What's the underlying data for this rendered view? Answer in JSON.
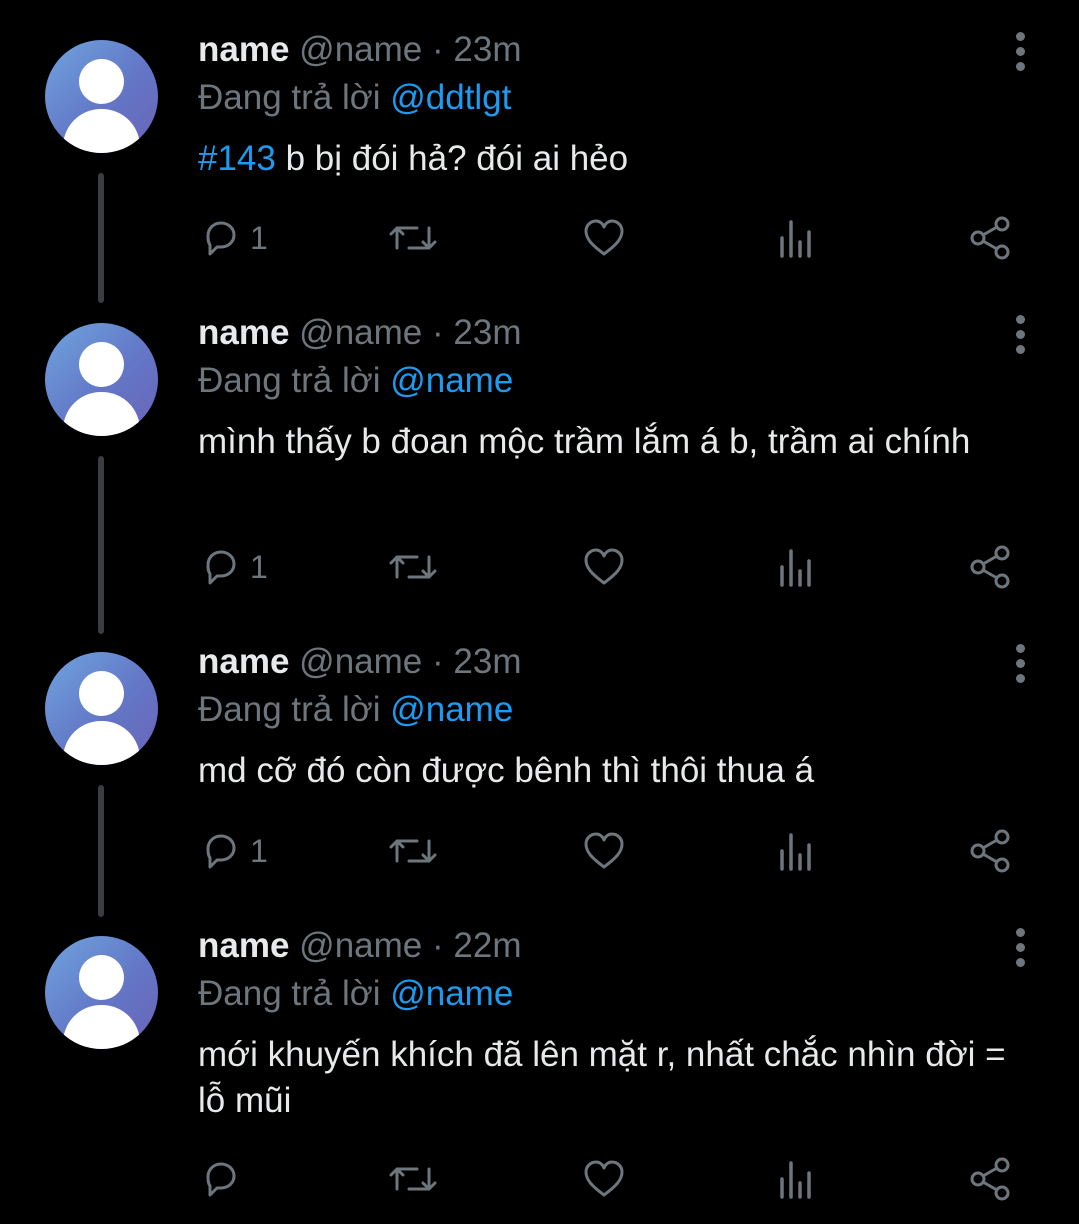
{
  "tweets": [
    {
      "name": "name",
      "handle": "@name",
      "time": "23m",
      "replying_label": "Đang trả lời",
      "reply_to": "@ddtlgt",
      "hashtag": "#143",
      "text": " b bị đói hả? đói ai hẻo",
      "reply_count": "1"
    },
    {
      "name": "name",
      "handle": "@name",
      "time": "23m",
      "replying_label": "Đang trả lời",
      "reply_to": "@name",
      "hashtag": "",
      "text": "mình thấy b đoan mộc trầm lắm á b, trầm ai chính",
      "reply_count": "1"
    },
    {
      "name": "name",
      "handle": "@name",
      "time": "23m",
      "replying_label": "Đang trả lời",
      "reply_to": "@name",
      "hashtag": "",
      "text": "md cỡ đó còn được bênh thì thôi thua á",
      "reply_count": "1"
    },
    {
      "name": "name",
      "handle": "@name",
      "time": "22m",
      "replying_label": "Đang trả lời",
      "reply_to": "@name",
      "hashtag": "",
      "text": "mới khuyến khích đã lên mặt r, nhất chắc nhìn đời = lỗ mũi",
      "reply_count": ""
    }
  ],
  "separator": "·",
  "colors": {
    "background": "#000000",
    "text": "#e7e9ea",
    "muted": "#6e767d",
    "accent": "#1d9bf0",
    "thread_line": "#3a3d40"
  },
  "icons": [
    "reply-icon",
    "retweet-icon",
    "like-icon",
    "analytics-icon",
    "share-icon",
    "more-icon",
    "avatar-icon"
  ]
}
